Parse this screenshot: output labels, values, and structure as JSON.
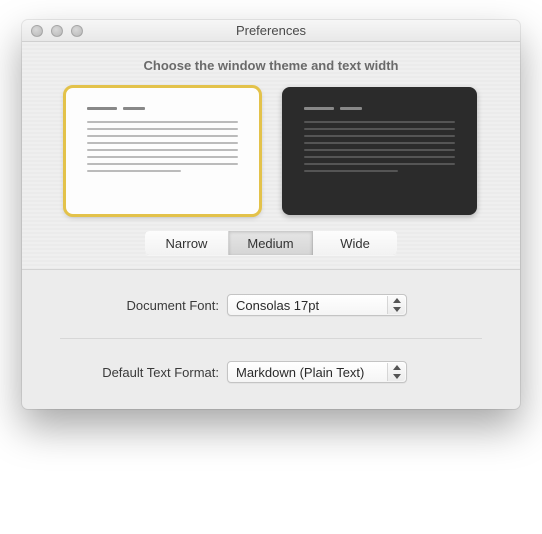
{
  "window": {
    "title": "Preferences"
  },
  "theme_section": {
    "header": "Choose the window theme and text width",
    "widths": {
      "narrow": "Narrow",
      "medium": "Medium",
      "wide": "Wide"
    }
  },
  "form": {
    "document_font": {
      "label": "Document Font:",
      "value": "Consolas 17pt"
    },
    "default_format": {
      "label": "Default Text Format:",
      "value": "Markdown (Plain Text)"
    }
  }
}
